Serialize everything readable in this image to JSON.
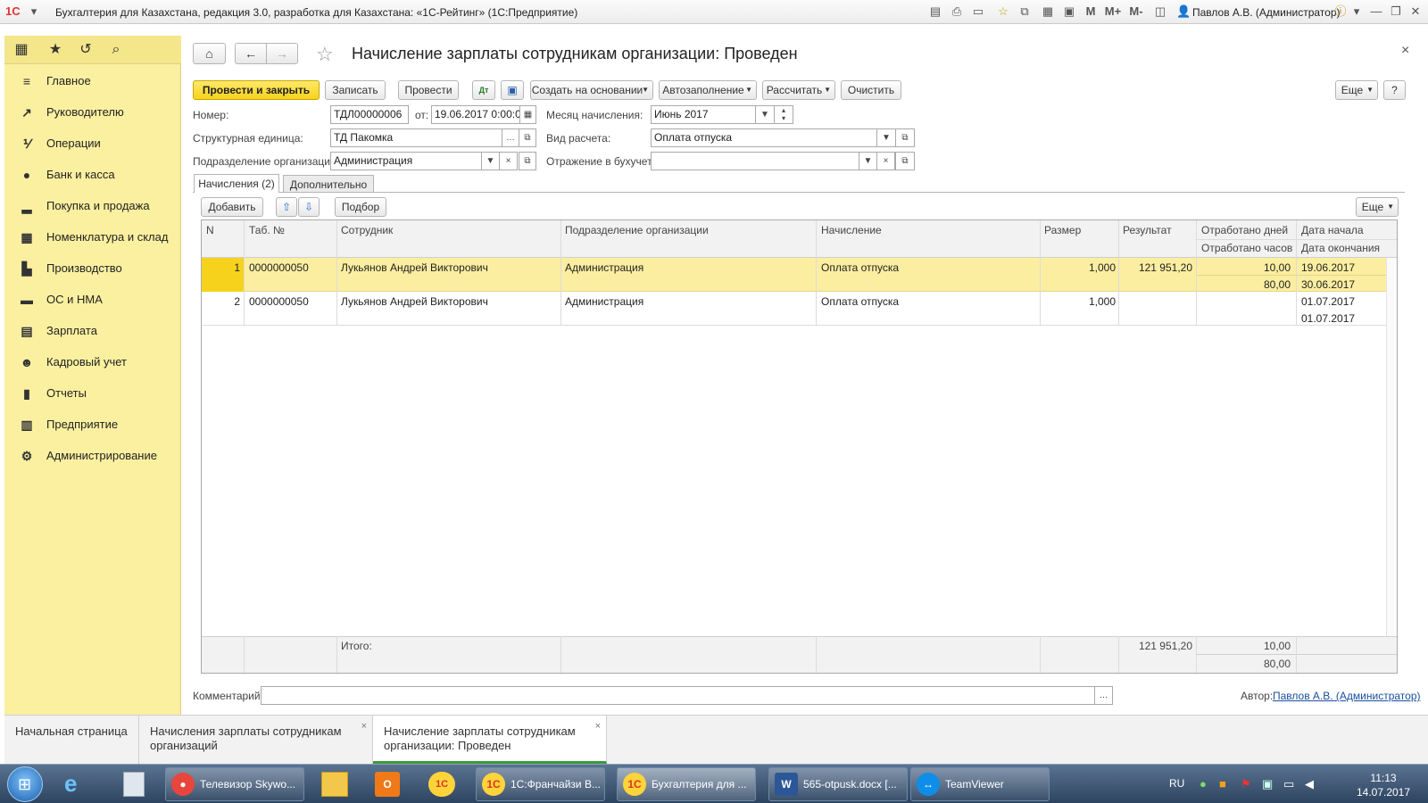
{
  "window": {
    "title": "Бухгалтерия для Казахстана, редакция 3.0, разработка для Казахстана: «1С-Рейтинг»  (1С:Предприятие)",
    "user": "Павлов А.В. (Администратор)",
    "mem_labels": [
      "M",
      "M+",
      "M-"
    ]
  },
  "sidebar": {
    "items": [
      {
        "label": "Главное",
        "icon": "menu-icon"
      },
      {
        "label": "Руководителю",
        "icon": "chart-line-icon"
      },
      {
        "label": "Операции",
        "icon": "operations-icon"
      },
      {
        "label": "Банк и касса",
        "icon": "bank-icon"
      },
      {
        "label": "Покупка и продажа",
        "icon": "cart-icon"
      },
      {
        "label": "Номенклатура и склад",
        "icon": "warehouse-icon"
      },
      {
        "label": "Производство",
        "icon": "factory-icon"
      },
      {
        "label": "ОС и НМА",
        "icon": "truck-icon"
      },
      {
        "label": "Зарплата",
        "icon": "salary-icon"
      },
      {
        "label": "Кадровый учет",
        "icon": "people-icon"
      },
      {
        "label": "Отчеты",
        "icon": "bar-chart-icon"
      },
      {
        "label": "Предприятие",
        "icon": "enterprise-icon"
      },
      {
        "label": "Администрирование",
        "icon": "gear-icon"
      }
    ]
  },
  "doc": {
    "title": "Начисление зарплаты сотрудникам организации: Проведен",
    "close": "×"
  },
  "toolbar": {
    "post_close": "Провести и закрыть",
    "save": "Записать",
    "post": "Провести",
    "create_based": "Создать на основании",
    "autofill": "Автозаполнение",
    "calculate": "Рассчитать",
    "clear": "Очистить",
    "more": "Еще",
    "help": "?"
  },
  "form": {
    "number_label": "Номер:",
    "number_value": "ТДЛ00000006",
    "date_label": "от:",
    "date_value": "19.06.2017  0:00:00",
    "month_label": "Месяц начисления:",
    "month_value": "Июнь 2017",
    "unit_label": "Структурная единица:",
    "unit_value": "ТД Пакомка",
    "calc_type_label": "Вид расчета:",
    "calc_type_value": "Оплата отпуска",
    "dept_label": "Подразделение организации:",
    "dept_value": "Администрация",
    "reflection_label": "Отражение в бухучете:",
    "reflection_value": ""
  },
  "tabs": [
    "Начисления (2)",
    "Дополнительно"
  ],
  "table_toolbar": {
    "add": "Добавить",
    "pick": "Подбор",
    "more": "Еще"
  },
  "table": {
    "headers": {
      "n": "N",
      "tab": "Таб. №",
      "employee": "Сотрудник",
      "dept": "Подразделение организации",
      "accrual": "Начисление",
      "size": "Размер",
      "result": "Результат",
      "days": "Отработано дней",
      "hours": "Отработано часов",
      "start": "Дата начала",
      "end": "Дата окончания"
    },
    "rows": [
      {
        "n": "1",
        "tab": "0000000050",
        "employee": "Лукьянов Андрей Викторович",
        "dept": "Администрация",
        "accrual": "Оплата отпуска",
        "size": "1,000",
        "result": "121 951,20",
        "days": "10,00",
        "hours": "80,00",
        "start": "19.06.2017",
        "end": "30.06.2017"
      },
      {
        "n": "2",
        "tab": "0000000050",
        "employee": "Лукьянов Андрей Викторович",
        "dept": "Администрация",
        "accrual": "Оплата отпуска",
        "size": "1,000",
        "result": "",
        "days": "",
        "hours": "",
        "start": "01.07.2017",
        "end": "01.07.2017"
      }
    ],
    "totals": {
      "label": "Итого:",
      "result": "121 951,20",
      "days": "10,00",
      "hours": "80,00"
    }
  },
  "footer": {
    "comment_label": "Комментарий:",
    "comment_value": "",
    "author_label": "Автор:",
    "author_value": "Павлов А.В. (Администратор)"
  },
  "bottom_tabs": [
    {
      "label": "Начальная страница"
    },
    {
      "label": "Начисления зарплаты сотрудникам организаций"
    },
    {
      "label": "Начисление зарплаты сотрудникам организации: Проведен"
    }
  ],
  "taskbar": {
    "items": [
      {
        "label": "Телевизор Skywo..."
      },
      {
        "label": "1С:Франчайзи В..."
      },
      {
        "label": "Бухгалтерия для ..."
      },
      {
        "label": "565-otpusk.docx [..."
      },
      {
        "label": "TeamViewer"
      }
    ],
    "lang": "RU",
    "time": "11:13",
    "date": "14.07.2017"
  },
  "colors": {
    "accent_yellow": "#f7d21c",
    "sidebar_bg": "#fbf0a0",
    "selected_row": "#fbeea0"
  }
}
